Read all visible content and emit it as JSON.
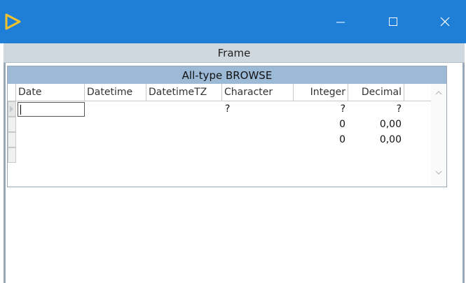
{
  "window": {
    "icon": "play-triangle-icon",
    "accent": "#1f7fd6",
    "minimize_glyph": "—",
    "maximize_glyph": "☐",
    "close_glyph": "✕"
  },
  "frame": {
    "title": "Frame"
  },
  "browse": {
    "title": "All-type BROWSE",
    "columns": {
      "date": "Date",
      "datetime": "Datetime",
      "datetimetz": "DatetimeTZ",
      "character": "Character",
      "integer": "Integer",
      "decimal": "Decimal"
    },
    "rows": [
      {
        "date": "",
        "datetime": "",
        "datetimetz": "",
        "character": "?",
        "integer": "?",
        "decimal": "?"
      },
      {
        "date": "",
        "datetime": "",
        "datetimetz": "",
        "character": "",
        "integer": "0",
        "decimal": "0,00"
      },
      {
        "date": "",
        "datetime": "",
        "datetimetz": "",
        "character": "",
        "integer": "0",
        "decimal": "0,00"
      },
      {
        "date": "",
        "datetime": "",
        "datetimetz": "",
        "character": "",
        "integer": "",
        "decimal": ""
      }
    ]
  }
}
